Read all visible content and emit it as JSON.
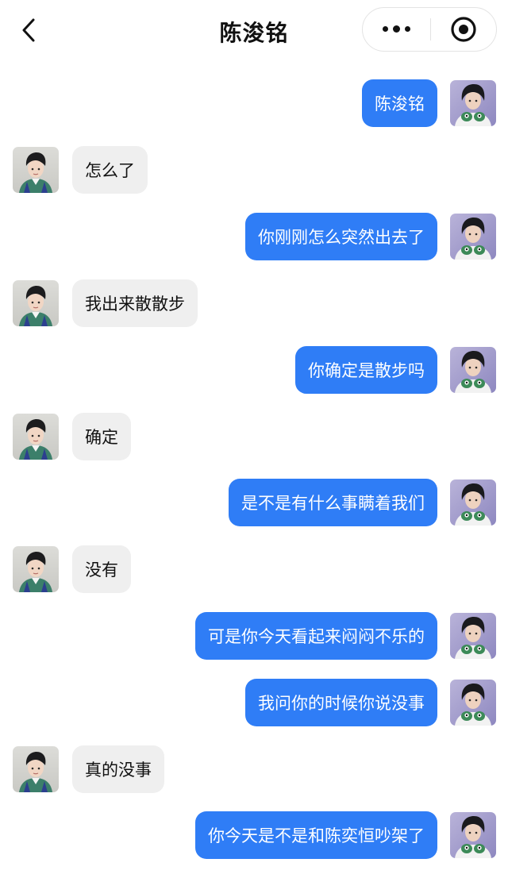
{
  "header": {
    "title": "陈浚铭",
    "back_icon": "chevron-left-icon",
    "more_icon": "more-dots-icon",
    "close_icon": "target-circle-icon"
  },
  "colors": {
    "outgoing_bubble": "#2f7df6",
    "incoming_bubble": "#efefef",
    "text_dark": "#111111"
  },
  "messages": [
    {
      "side": "right",
      "text": "陈浚铭"
    },
    {
      "side": "left",
      "text": "怎么了"
    },
    {
      "side": "right",
      "text": "你刚刚怎么突然出去了"
    },
    {
      "side": "left",
      "text": "我出来散散步"
    },
    {
      "side": "right",
      "text": "你确定是散步吗"
    },
    {
      "side": "left",
      "text": "确定"
    },
    {
      "side": "right",
      "text": "是不是有什么事瞒着我们"
    },
    {
      "side": "left",
      "text": "没有"
    },
    {
      "side": "right",
      "text": "可是你今天看起来闷闷不乐的"
    },
    {
      "side": "right",
      "text": "我问你的时候你说没事"
    },
    {
      "side": "left",
      "text": "真的没事"
    },
    {
      "side": "right",
      "text": "你今天是不是和陈奕恒吵架了"
    }
  ]
}
